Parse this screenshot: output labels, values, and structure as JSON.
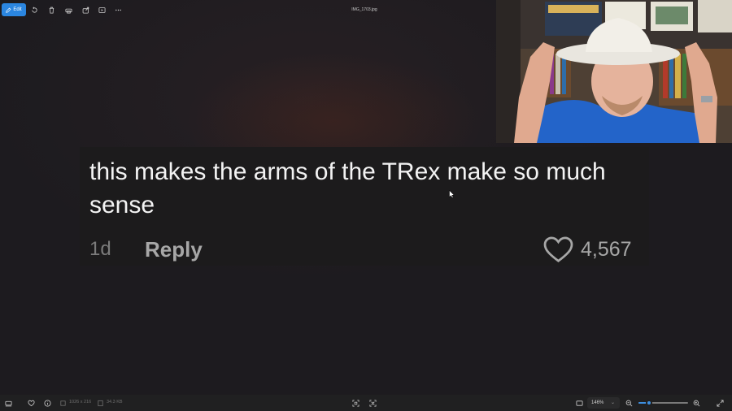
{
  "toolbar": {
    "edit_label": "Edit",
    "file_name": "IMG_1703.jpg",
    "icons": [
      "rotate-icon",
      "delete-icon",
      "print-icon",
      "share-icon",
      "slideshow-icon",
      "more-icon"
    ]
  },
  "comment": {
    "text": "this makes the arms of the TRex make so much sense",
    "age": "1d",
    "reply_label": "Reply",
    "likes": "4,567"
  },
  "statusbar": {
    "dimensions": "1026 x 216",
    "file_size": "34.3 KB",
    "zoom_level": "146%",
    "zoom_fraction": 0.22
  },
  "colors": {
    "accent": "#2b86e0",
    "background": "#1d1b1f",
    "card": "#1c1b1c"
  }
}
